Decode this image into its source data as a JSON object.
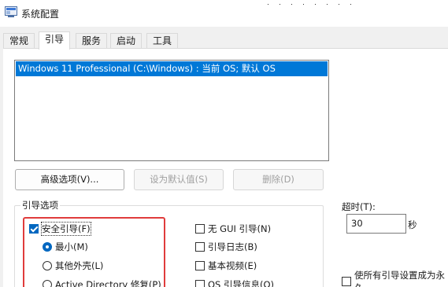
{
  "window": {
    "title": "系统配置",
    "icon": "msconfig-icon"
  },
  "tabs": [
    {
      "label": "常规",
      "active": false
    },
    {
      "label": "引导",
      "active": true
    },
    {
      "label": "服务",
      "active": false
    },
    {
      "label": "启动",
      "active": false
    },
    {
      "label": "工具",
      "active": false
    }
  ],
  "os_list": {
    "items": [
      "Windows 11 Professional (C:\\Windows) : 当前 OS; 默认 OS"
    ],
    "selected_index": 0
  },
  "buttons": {
    "advanced": "高级选项(V)...",
    "set_default": "设为默认值(S)",
    "delete": "删除(D)"
  },
  "boot_options": {
    "group_label": "引导选项",
    "safe_boot": {
      "label": "安全引导(F)",
      "checked": true
    },
    "minimal": {
      "label": "最小(M)",
      "checked": true
    },
    "alternate_shell": {
      "label": "其他外壳(L)",
      "checked": false
    },
    "active_directory": {
      "label": "Active Directory 修复(P)",
      "checked": false
    },
    "no_gui_boot": {
      "label": "无 GUI 引导(N)",
      "checked": false
    },
    "boot_log": {
      "label": "引导日志(B)",
      "checked": false
    },
    "base_video": {
      "label": "基本视频(E)",
      "checked": false
    },
    "os_boot_info": {
      "label": "OS 引导信息(O)",
      "checked": false
    }
  },
  "timeout": {
    "label": "超时(T):",
    "value": "30",
    "unit": "秒"
  },
  "persist": {
    "label": "使所有引导设置成为永久",
    "checked": false
  },
  "colors": {
    "selection": "#0078d7",
    "checkbox_accent": "#0067c0",
    "highlight_box": "#e03c3c"
  }
}
